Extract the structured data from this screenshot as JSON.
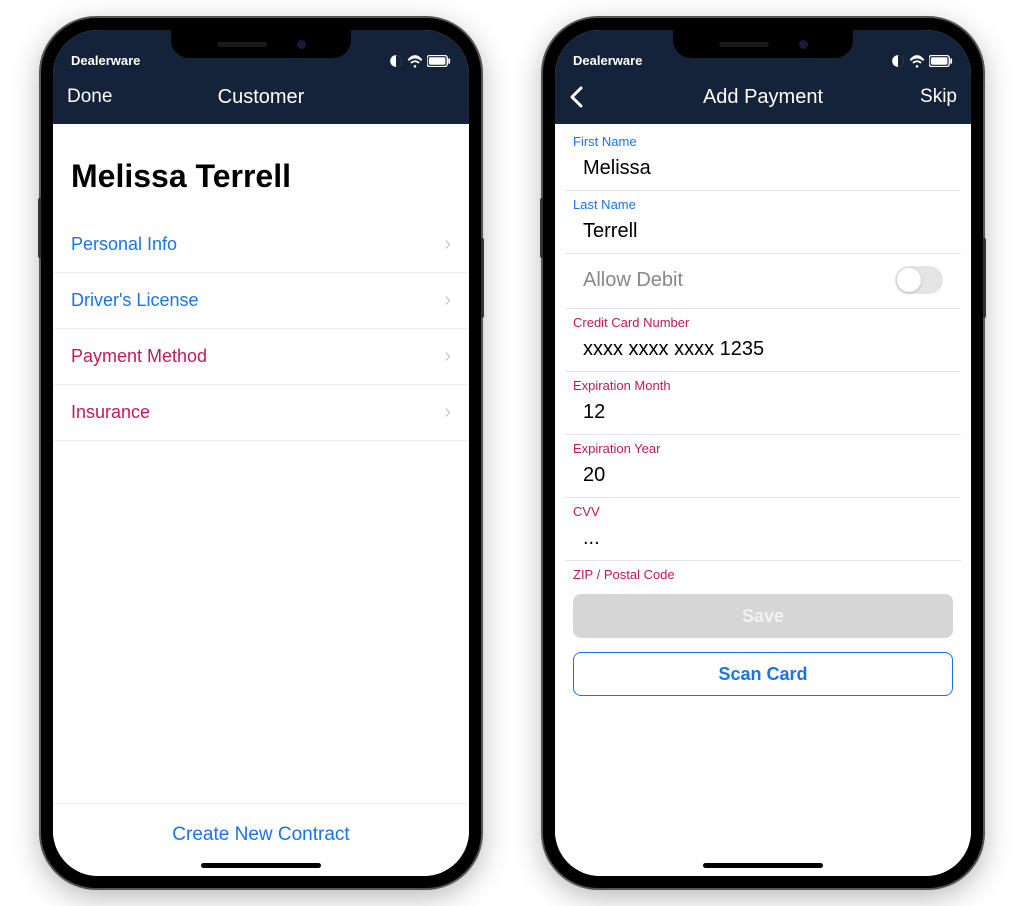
{
  "status": {
    "brand": "Dealerware"
  },
  "left": {
    "nav": {
      "done": "Done",
      "title": "Customer"
    },
    "customer_name": "Melissa Terrell",
    "menu": {
      "personal": "Personal Info",
      "license": "Driver's License",
      "payment": "Payment Method",
      "insurance": "Insurance"
    },
    "footer": "Create New Contract"
  },
  "right": {
    "nav": {
      "title": "Add Payment",
      "skip": "Skip"
    },
    "fields": {
      "first_name": {
        "label": "First Name",
        "value": "Melissa"
      },
      "last_name": {
        "label": "Last Name",
        "value": "Terrell"
      },
      "allow_debit": {
        "label": "Allow Debit",
        "on": false
      },
      "card": {
        "label": "Credit Card Number",
        "value": "xxxx xxxx xxxx 1235"
      },
      "month": {
        "label": "Expiration Month",
        "value": "12"
      },
      "year": {
        "label": "Expiration Year",
        "value": "20"
      },
      "cvv": {
        "label": "CVV",
        "value": "..."
      },
      "zip": {
        "label": "ZIP / Postal Code"
      }
    },
    "buttons": {
      "save": "Save",
      "scan": "Scan Card"
    }
  }
}
